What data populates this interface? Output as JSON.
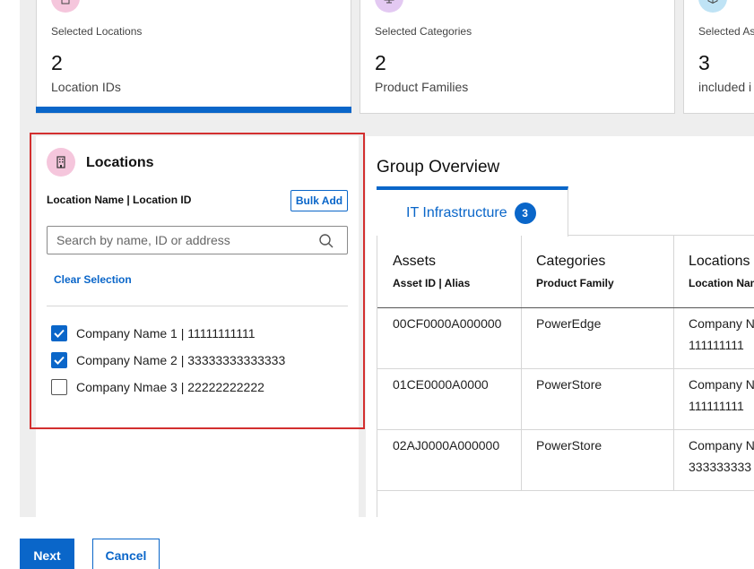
{
  "summary_cards": [
    {
      "label": "Selected Locations",
      "count": "2",
      "sub": "Location IDs",
      "icon": "building-icon",
      "icon_color": "#f5c6dc"
    },
    {
      "label": "Selected Categories",
      "count": "2",
      "sub": "Product Families",
      "icon": "monitor-icon",
      "icon_color": "#e3c9f2"
    },
    {
      "label": "Selected As",
      "count": "3",
      "sub": "included i",
      "icon": "cube-icon",
      "icon_color": "#bfe3f5"
    }
  ],
  "locations": {
    "title": "Locations",
    "subtitle": "Location Name | Location ID",
    "bulk_add_label": "Bulk Add",
    "search_placeholder": "Search by name, ID or address",
    "clear_selection_label": "Clear Selection",
    "items": [
      {
        "label": "Company Name 1 | 11111111111",
        "checked": true
      },
      {
        "label": "Company Name 2 | 33333333333333",
        "checked": true
      },
      {
        "label": "Company Nmae 3 | 22222222222",
        "checked": false
      }
    ]
  },
  "group_overview": {
    "title": "Group Overview",
    "tab_label": "IT Infrastructure",
    "tab_count": "3",
    "columns": [
      {
        "title": "Assets",
        "subtitle": "Asset ID | Alias"
      },
      {
        "title": "Categories",
        "subtitle": "Product Family"
      },
      {
        "title": "Locations",
        "subtitle": "Location Nam"
      }
    ],
    "rows": [
      {
        "asset": "00CF0000A000000",
        "category": "PowerEdge",
        "location_line1": "Company N",
        "location_line2": "111111111"
      },
      {
        "asset": "01CE0000A0000",
        "category": "PowerStore",
        "location_line1": "Company N",
        "location_line2": "111111111"
      },
      {
        "asset": "02AJ0000A000000",
        "category": "PowerStore",
        "location_line1": "Company N",
        "location_line2": "333333333"
      }
    ]
  },
  "footer": {
    "next_label": "Next",
    "cancel_label": "Cancel"
  },
  "colors": {
    "accent": "#0a66c9",
    "highlight": "#d32f2f"
  }
}
